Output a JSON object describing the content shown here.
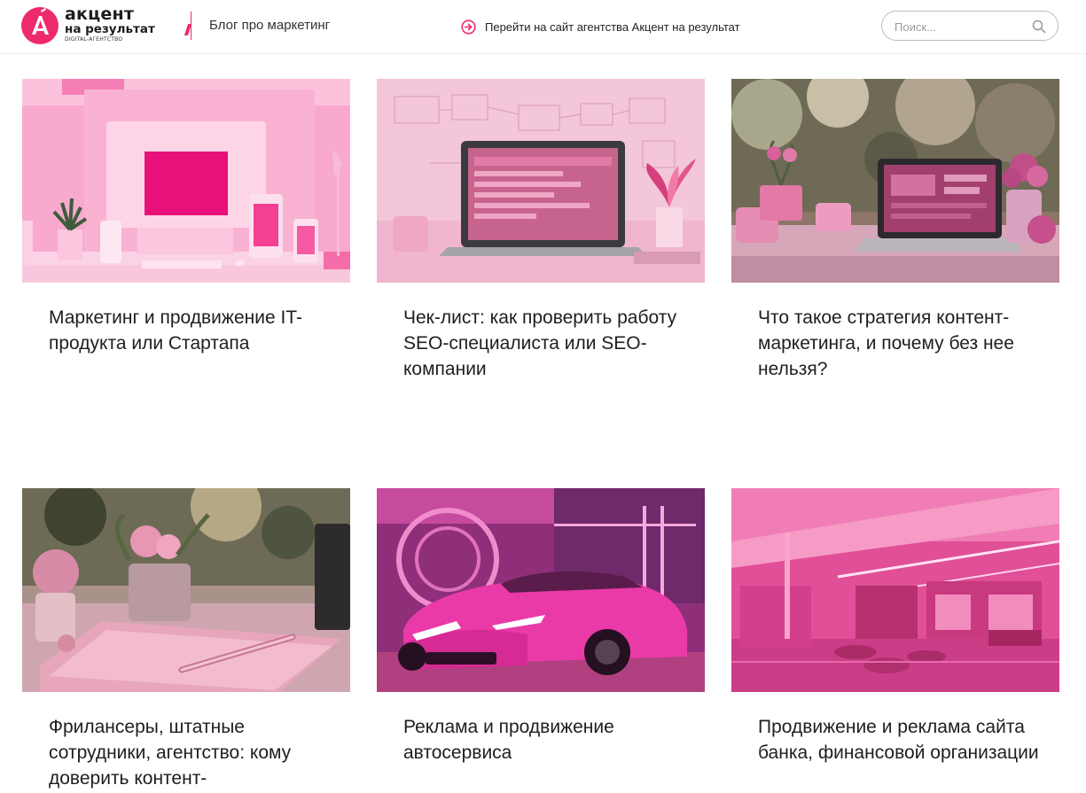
{
  "header": {
    "logo": {
      "line1": "акцент",
      "line2": "на результат",
      "line3": "DIGITAL-АГЕНТСТВО"
    },
    "blog_title": "Блог про маркетинг",
    "agency_link": "Перейти на сайт агентства Акцент на результат",
    "search": {
      "placeholder": "Поиск..."
    }
  },
  "colors": {
    "accent": "#ee2a6f"
  },
  "posts": [
    {
      "title": "Маркетинг и продвижение IT-продукта или Стартапа",
      "image": "pink-desktop-workspace"
    },
    {
      "title": "Чек-лист: как проверить работу SEO-специалиста или SEO-компании",
      "image": "pink-laptop-infographics"
    },
    {
      "title": "Что такое стратегия контент-маркетинга, и почему без нее нельзя?",
      "image": "laptop-on-cafe-table"
    },
    {
      "title": "Фрилансеры, штатные сотрудники, агентство: кому доверить контент-",
      "image": "pink-notebook-and-pen"
    },
    {
      "title": "Реклама и продвижение автосервиса",
      "image": "pink-sports-car"
    },
    {
      "title": "Продвижение и реклама сайта банка, финансовой организации",
      "image": "pink-bank-interior"
    }
  ]
}
